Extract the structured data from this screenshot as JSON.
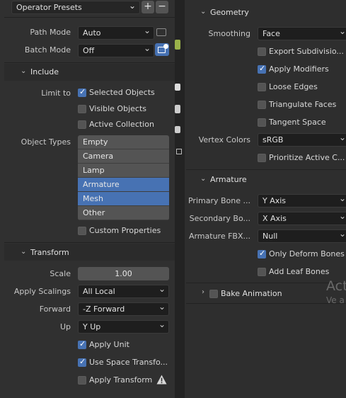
{
  "presets": {
    "label": "Operator Presets",
    "add": "+",
    "remove": "−"
  },
  "left": {
    "path_mode": {
      "label": "Path Mode",
      "value": "Auto"
    },
    "batch_mode": {
      "label": "Batch Mode",
      "value": "Off"
    },
    "include": {
      "header": "Include",
      "limit_to_label": "Limit to",
      "selected_objects": "Selected Objects",
      "visible_objects": "Visible Objects",
      "active_collection": "Active Collection",
      "object_types_label": "Object Types",
      "object_types": [
        {
          "label": "Empty"
        },
        {
          "label": "Camera"
        },
        {
          "label": "Lamp"
        },
        {
          "label": "Armature"
        },
        {
          "label": "Mesh"
        },
        {
          "label": "Other"
        }
      ],
      "custom_properties": "Custom Properties"
    },
    "transform": {
      "header": "Transform",
      "scale_label": "Scale",
      "scale_value": "1.00",
      "apply_scalings_label": "Apply Scalings",
      "apply_scalings_value": "All Local",
      "forward_label": "Forward",
      "forward_value": "-Z Forward",
      "up_label": "Up",
      "up_value": "Y Up",
      "apply_unit": "Apply Unit",
      "use_space_transform": "Use Space Transfo...",
      "apply_transform": "Apply Transform"
    }
  },
  "right": {
    "geometry": {
      "header": "Geometry",
      "smoothing_label": "Smoothing",
      "smoothing_value": "Face",
      "export_subdivision": "Export Subdivisio...",
      "apply_modifiers": "Apply Modifiers",
      "loose_edges": "Loose Edges",
      "triangulate_faces": "Triangulate Faces",
      "tangent_space": "Tangent Space",
      "vertex_colors_label": "Vertex Colors",
      "vertex_colors_value": "sRGB",
      "prioritize_active": "Prioritize Active C..."
    },
    "armature": {
      "header": "Armature",
      "primary_bone_label": "Primary Bone ...",
      "primary_bone_value": "Y Axis",
      "secondary_bone_label": "Secondary Bo...",
      "secondary_bone_value": "X Axis",
      "armature_fbx_label": "Armature FBX...",
      "armature_fbx_value": "Null",
      "only_deform_bones": "Only Deform Bones",
      "add_leaf_bones": "Add Leaf Bones"
    },
    "bake_animation": {
      "header": "Bake Animation"
    },
    "watermark": {
      "line1": "Act",
      "line2": "Ve a"
    }
  }
}
